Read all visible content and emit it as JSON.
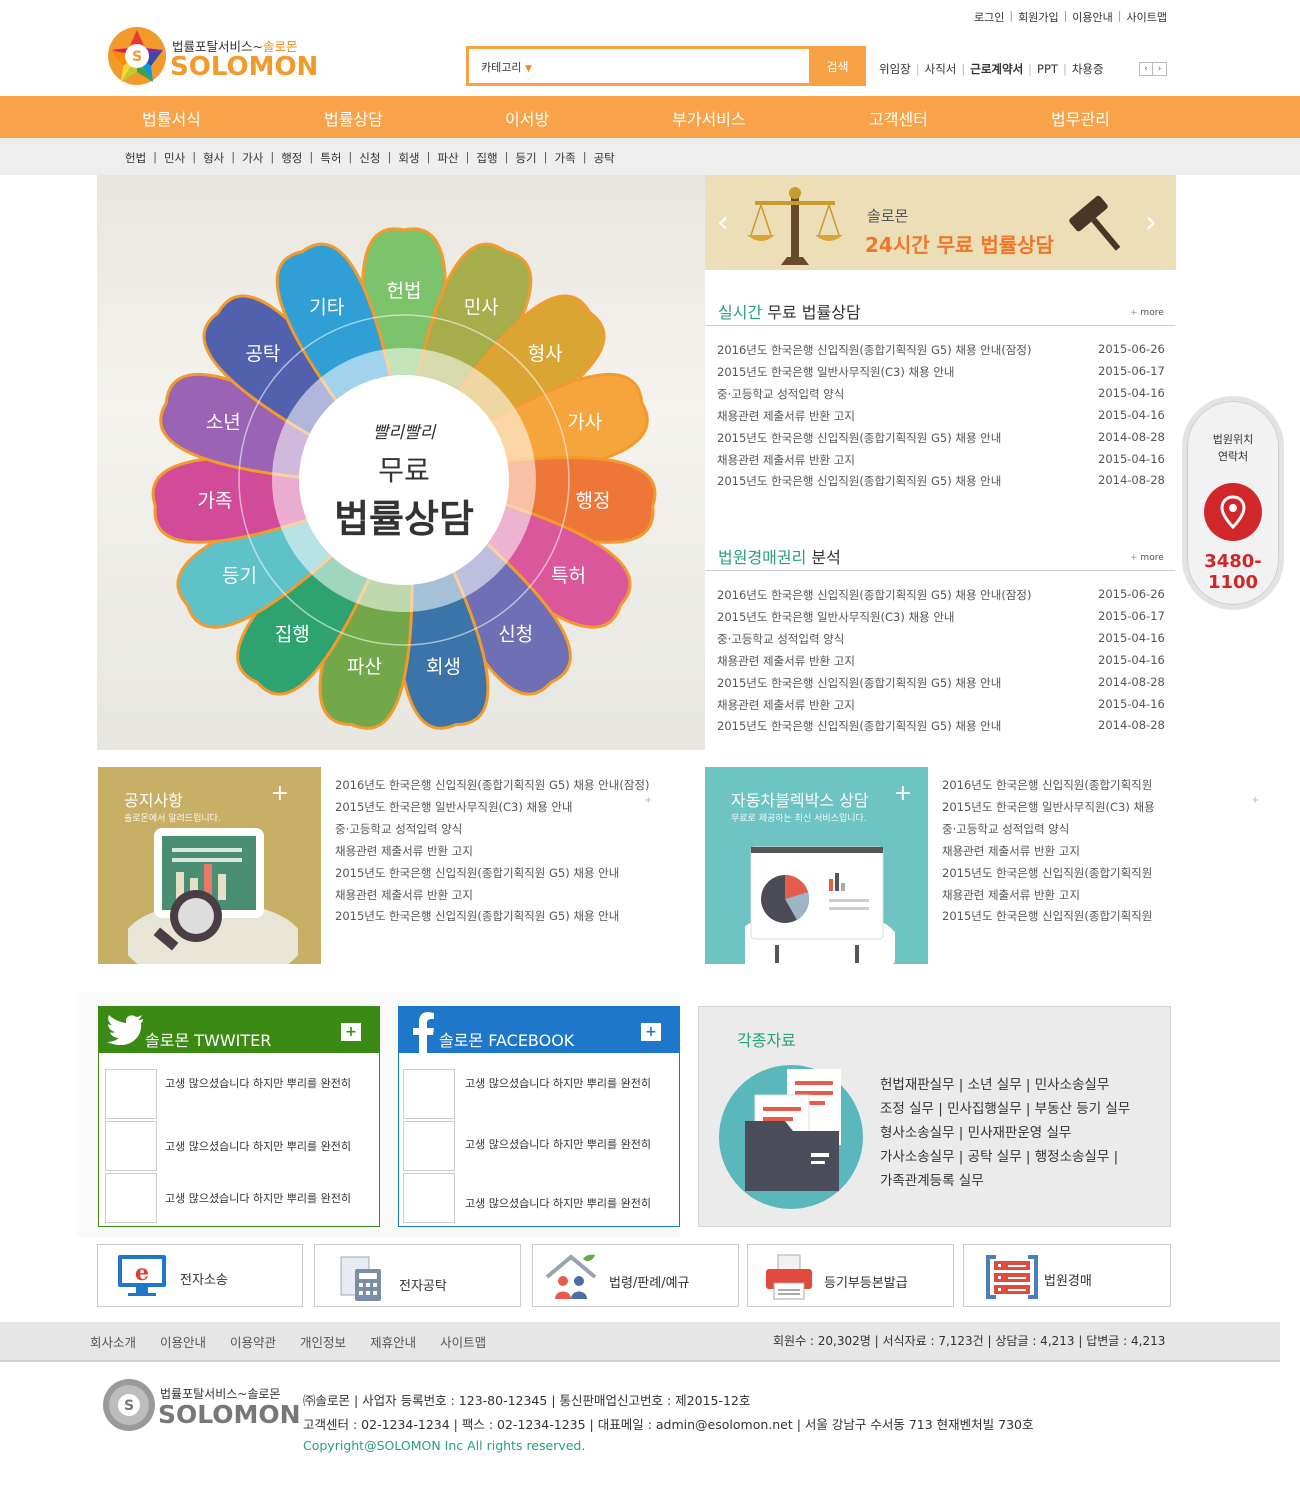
{
  "header": {
    "top_links": [
      "로그인",
      "회원가입",
      "이용안내",
      "사이트맵"
    ],
    "logo_sub": "법률포탈서비스~",
    "logo_sub_em": "솔로몬",
    "logo_main": "SOLOMON",
    "logo_letter": "S",
    "search_category": "카테고리",
    "search_button": "검색",
    "quick_links": [
      "위임장",
      "사직서",
      "근로계약서",
      "PPT",
      "차용증"
    ],
    "quick_prev": "‹",
    "quick_next": "›"
  },
  "nav": [
    "법률서식",
    "법률상담",
    "이서방",
    "부가서비스",
    "고객센터",
    "법무관리"
  ],
  "subnav": [
    "헌법",
    "민사",
    "형사",
    "가사",
    "행정",
    "특허",
    "신청",
    "회생",
    "파산",
    "집행",
    "등기",
    "가족",
    "공탁"
  ],
  "flower": {
    "petals": [
      {
        "label": "헌법",
        "color": "#7dc36b"
      },
      {
        "label": "민사",
        "color": "#a6ad4a"
      },
      {
        "label": "형사",
        "color": "#d9a634"
      },
      {
        "label": "가사",
        "color": "#f5a53b"
      },
      {
        "label": "행정",
        "color": "#ef7639"
      },
      {
        "label": "특허",
        "color": "#d9579a"
      },
      {
        "label": "신청",
        "color": "#6f6fb5"
      },
      {
        "label": "회생",
        "color": "#3b74a8"
      },
      {
        "label": "파산",
        "color": "#72a84a"
      },
      {
        "label": "집행",
        "color": "#2ea36f"
      },
      {
        "label": "등기",
        "color": "#5fc2c8"
      },
      {
        "label": "가족",
        "color": "#d14b98"
      },
      {
        "label": "소년",
        "color": "#9a63b3"
      },
      {
        "label": "공탁",
        "color": "#5161ad"
      },
      {
        "label": "기타",
        "color": "#2f9fd6"
      }
    ],
    "center_small": "빨리빨리",
    "center_mid": "무료",
    "center_big": "법률상담"
  },
  "banner": {
    "small": "솔로몬",
    "large": "24시간 무료 법률상담",
    "prev": "‹",
    "next": "›"
  },
  "news1": {
    "title_em": "실시간",
    "title_rest": " 무료 법률상담",
    "more": "more",
    "items": [
      {
        "title": "2016년도 한국은행 신입직원(종합기획직원 G5) 채용 안내(잠정)",
        "date": "2015-06-26"
      },
      {
        "title": "2015년도 한국은행 일반사무직원(C3) 채용 안내",
        "date": "2015-06-17"
      },
      {
        "title": "중·고등학교 성적입력 양식",
        "date": "2015-04-16"
      },
      {
        "title": "채용관련 제출서류 반환 고지",
        "date": "2015-04-16"
      },
      {
        "title": "2015년도 한국은행 신입직원(종합기획직원 G5) 채용 안내",
        "date": "2014-08-28"
      },
      {
        "title": "채용관련 제출서류 반환 고지",
        "date": "2015-04-16"
      },
      {
        "title": "2015년도 한국은행 신입직원(종합기획직원 G5) 채용 안내",
        "date": "2014-08-28"
      }
    ]
  },
  "news2": {
    "title_em": "법원경매권리",
    "title_rest": " 분석",
    "more": "more",
    "items": [
      {
        "title": "2016년도 한국은행 신입직원(종합기획직원 G5) 채용 안내(잠정)",
        "date": "2015-06-26"
      },
      {
        "title": "2015년도 한국은행 일반사무직원(C3) 채용 안내",
        "date": "2015-06-17"
      },
      {
        "title": "중·고등학교 성적입력 양식",
        "date": "2015-04-16"
      },
      {
        "title": "채용관련 제출서류 반환 고지",
        "date": "2015-04-16"
      },
      {
        "title": "2015년도 한국은행 신입직원(종합기획직원 G5) 채용 안내",
        "date": "2014-08-28"
      },
      {
        "title": "채용관련 제출서류 반환 고지",
        "date": "2015-04-16"
      },
      {
        "title": "2015년도 한국은행 신입직원(종합기획직원 G5) 채용 안내",
        "date": "2014-08-28"
      }
    ]
  },
  "side": {
    "line1": "법원위치",
    "line2": "연락처",
    "phone": "3480-1100"
  },
  "notice": {
    "title": "공지사항",
    "sub": "솔로몬에서 알려드립니다.",
    "plus": "+",
    "items": [
      "2016년도 한국은행 신입직원(종합기획직원 G5) 채용 안내(잠정)",
      "2015년도 한국은행 일반사무직원(C3) 채용 안내",
      "중·고등학교 성적입력 양식",
      "채용관련 제출서류 반환 고지",
      "2015년도 한국은행 신입직원(종합기획직원 G5) 채용 안내",
      "채용관련 제출서류 반환 고지",
      "2015년도 한국은행 신입직원(종합기획직원 G5) 채용 안내"
    ]
  },
  "car": {
    "title": "자동차블렉박스 상담",
    "sub": "무료로 제공하는 최신 서비스입니다.",
    "plus": "+",
    "items": [
      "2016년도 한국은행 신입직원(종합기획직원",
      "2015년도 한국은행 일반사무직원(C3) 채용",
      "중·고등학교 성적입력 양식",
      "채용관련 제출서류 반환 고지",
      "2015년도 한국은행 신입직원(종합기획직원",
      "채용관련 제출서류 반환 고지",
      "2015년도 한국은행 신입직원(종합기획직원"
    ]
  },
  "twitter": {
    "title": "솔로몬 TWWITER",
    "color": "#3a8a14",
    "plus": "+",
    "items": [
      "고생 많으셨습니다 하지만 뿌리를 완전히",
      "고생 많으셨습니다 하지만 뿌리를 완전히",
      "고생 많으셨습니다 하지만 뿌리를 완전히"
    ]
  },
  "facebook": {
    "title": "솔로몬 FACEBOOK",
    "color": "#1f77c9",
    "plus": "+",
    "items": [
      "고생 많으셨습니다 하지만 뿌리를 완전히",
      "고생 많으셨습니다 하지만 뿌리를 완전히",
      "고생 많으셨습니다 하지만 뿌리를 완전히"
    ]
  },
  "resources": {
    "title": "각종자료",
    "lines": [
      "헌법재판실무 | 소년 실무 | 민사소송실무",
      "조정 실무 | 민사집행실무 | 부동산 등기 실무",
      "형사소송실무 | 민사재판운영 실무",
      "가사소송실무 | 공탁 실무 | 행정소송실무 |",
      "가족관계등록 실무"
    ]
  },
  "quick_icons": [
    {
      "label": "전자소송",
      "icon": "monitor-e-icon"
    },
    {
      "label": "전자공탁",
      "icon": "calculator-icon"
    },
    {
      "label": "법령/판례/예규",
      "icon": "house-family-icon"
    },
    {
      "label": "등기부등본발급",
      "icon": "printer-icon"
    },
    {
      "label": "법원경매",
      "icon": "server-rack-icon"
    }
  ],
  "footer": {
    "links": [
      "회사소개",
      "이용안내",
      "이용약관",
      "개인정보",
      "제휴안내",
      "사이트맵"
    ],
    "stats": "회원수 : 20,302명  | 서식자료 : 7,123건 | 상담글 : 4,213 | 답변글 : 4,213",
    "logo_sub": "법률포탈서비스~솔로몬",
    "logo_main": "SOLOMON",
    "logo_letter": "S",
    "info1": "㈜솔로몬 | 사업자 등록번호 : 123-80-12345 | 통신판매업신고번호 : 제2015-12호",
    "info2": "고객센터 : 02-1234-1234 | 팩스 : 02-1234-1235  | 대표메일 : admin@esolomon.net | 서울 강남구 수서동 713 현재벤처빌 730호",
    "copyright": "Copyright@SOLOMON Inc All rights reserved."
  }
}
